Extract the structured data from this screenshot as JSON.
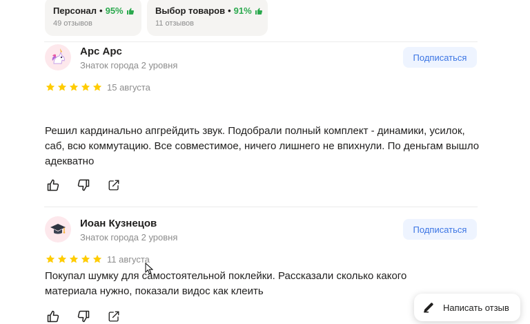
{
  "summary": [
    {
      "title": "Персонал",
      "percent": "95%",
      "reviews": "49 отзывов"
    },
    {
      "title": "Выбор товаров",
      "percent": "91%",
      "reviews": "11 отзывов"
    }
  ],
  "reviews": [
    {
      "author": "Арс Арс",
      "level": "Знаток города 2 уровня",
      "subscribe": "Подписаться",
      "rating": 5,
      "date": "15 августа",
      "text": "Решил кардинально апгрейдить звук. Подобрали полный комплект - динамики, усилок, саб, всю коммутацию. Все совместимое, ничего лишнего не впихнули. По деньгам вышло адекватно",
      "avatar_icon": "unicorn-icon"
    },
    {
      "author": "Иоан Кузнецов",
      "level": "Знаток города 2 уровня",
      "subscribe": "Подписаться",
      "rating": 5,
      "date": "11 августа",
      "text": "Покупал шумку для самостоятельной поклейки. Рассказали сколько какого материала нужно, показали видос как клеить",
      "avatar_icon": "graduation-cap-icon"
    }
  ],
  "write_review": {
    "label": "Написать отзыв",
    "icon": "pencil-icon"
  },
  "colors": {
    "star": "#ffcc00",
    "accent": "#3b75e4",
    "positive": "#2ba94e"
  }
}
